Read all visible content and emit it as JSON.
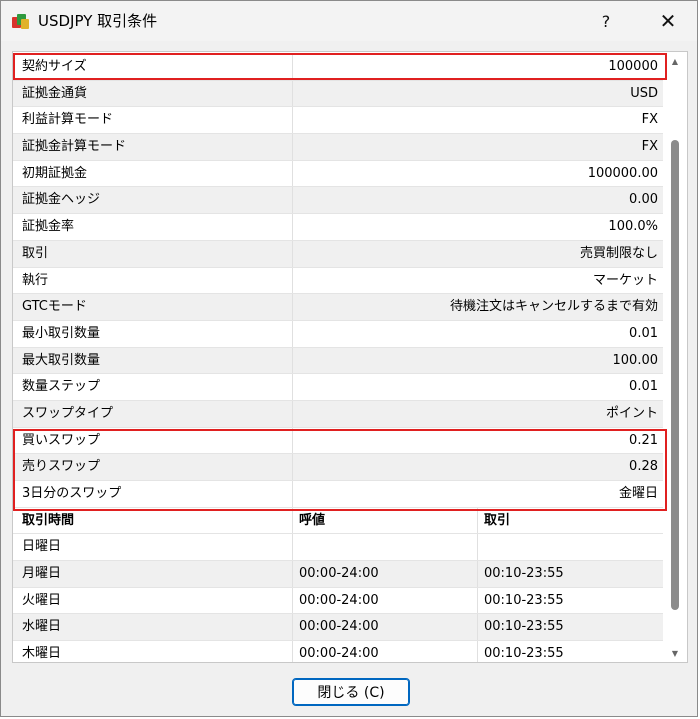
{
  "window": {
    "title": "USDJPY 取引条件",
    "help_glyph": "?",
    "close_glyph": "✕"
  },
  "specs": [
    {
      "label": "契約サイズ",
      "value": "100000"
    },
    {
      "label": "証拠金通貨",
      "value": "USD"
    },
    {
      "label": "利益計算モード",
      "value": "FX"
    },
    {
      "label": "証拠金計算モード",
      "value": "FX"
    },
    {
      "label": "初期証拠金",
      "value": "100000.00"
    },
    {
      "label": "証拠金ヘッジ",
      "value": "0.00"
    },
    {
      "label": "証拠金率",
      "value": "100.0%"
    },
    {
      "label": "取引",
      "value": "売買制限なし"
    },
    {
      "label": "執行",
      "value": "マーケット"
    },
    {
      "label": "GTCモード",
      "value": "待機注文はキャンセルするまで有効"
    },
    {
      "label": "最小取引数量",
      "value": "0.01"
    },
    {
      "label": "最大取引数量",
      "value": "100.00"
    },
    {
      "label": "数量ステップ",
      "value": "0.01"
    },
    {
      "label": "スワップタイプ",
      "value": "ポイント"
    },
    {
      "label": "買いスワップ",
      "value": "0.21"
    },
    {
      "label": "売りスワップ",
      "value": "0.28"
    },
    {
      "label": "3日分のスワップ",
      "value": "金曜日"
    }
  ],
  "schedule": {
    "headers": [
      "取引時間",
      "呼値",
      "取引"
    ],
    "rows": [
      [
        "日曜日",
        "",
        ""
      ],
      [
        "月曜日",
        "00:00-24:00",
        "00:10-23:55"
      ],
      [
        "火曜日",
        "00:00-24:00",
        "00:10-23:55"
      ],
      [
        "水曜日",
        "00:00-24:00",
        "00:10-23:55"
      ],
      [
        "木曜日",
        "00:00-24:00",
        "00:10-23:55"
      ]
    ]
  },
  "footer": {
    "close_label": "閉じる (C)"
  },
  "colors": {
    "highlight": "#e02020",
    "button_border": "#0067c0",
    "row_alt": "#f0f0f0"
  },
  "icons": {
    "app": "mt-symbol-icon",
    "scroll_up": "scroll-up-arrow-icon",
    "scroll_down": "scroll-down-arrow-icon"
  }
}
